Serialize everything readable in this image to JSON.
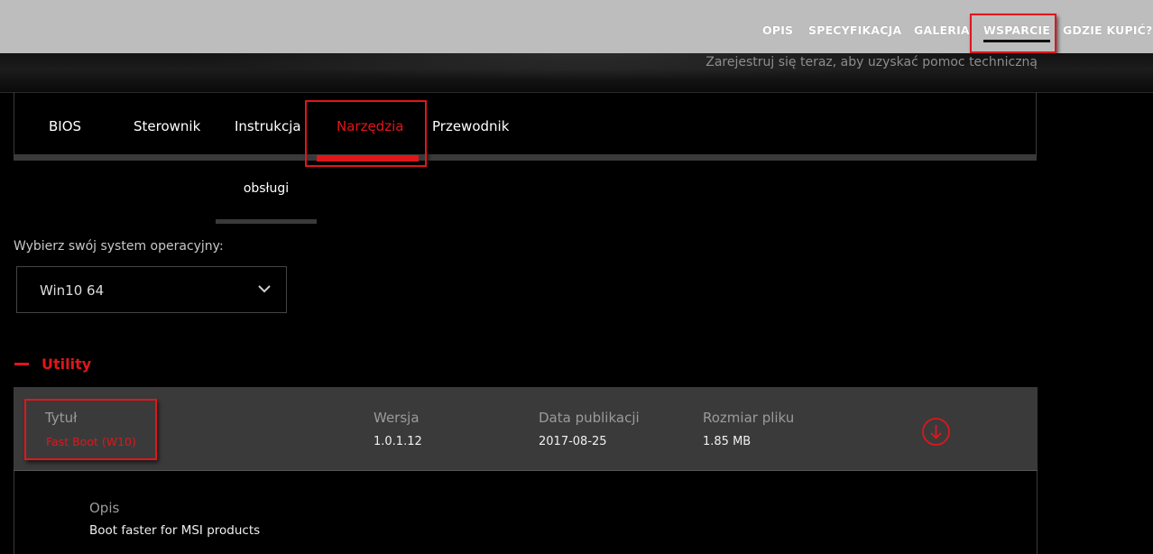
{
  "top_nav": {
    "items": [
      {
        "label": "OPIS"
      },
      {
        "label": "SPECYFIKACJA"
      },
      {
        "label": "GALERIA"
      },
      {
        "label": "WSPARCIE"
      },
      {
        "label": "GDZIE KUPIĆ?"
      }
    ],
    "active": "WSPARCIE"
  },
  "hero": {
    "register_text": "Zarejestruj się teraz, aby uzyskać pomoc techniczną"
  },
  "tabs": {
    "items": [
      {
        "label": "BIOS"
      },
      {
        "label": "Sterownik"
      },
      {
        "label": "Instrukcja"
      },
      {
        "label": "Narzędzia"
      },
      {
        "label": "Przewodnik"
      }
    ],
    "subtab": "obsługi",
    "active": "Narzędzia"
  },
  "os": {
    "label": "Wybierz swój system operacyjny:",
    "selected": "Win10 64"
  },
  "section": {
    "title": "Utility"
  },
  "table": {
    "headers": {
      "title": "Tytuł",
      "version": "Wersja",
      "date": "Data publikacji",
      "size": "Rozmiar pliku"
    },
    "row": {
      "title": "Fast Boot (W10)",
      "version": "1.0.1.12",
      "date": "2017-08-25",
      "size": "1.85 MB"
    },
    "description": {
      "header": "Opis",
      "text": "Boot faster for MSI products"
    }
  },
  "colors": {
    "accent": "#e0161b",
    "topbar": "#bdbdbd",
    "panel": "#3a3a3a",
    "background": "#000000"
  }
}
